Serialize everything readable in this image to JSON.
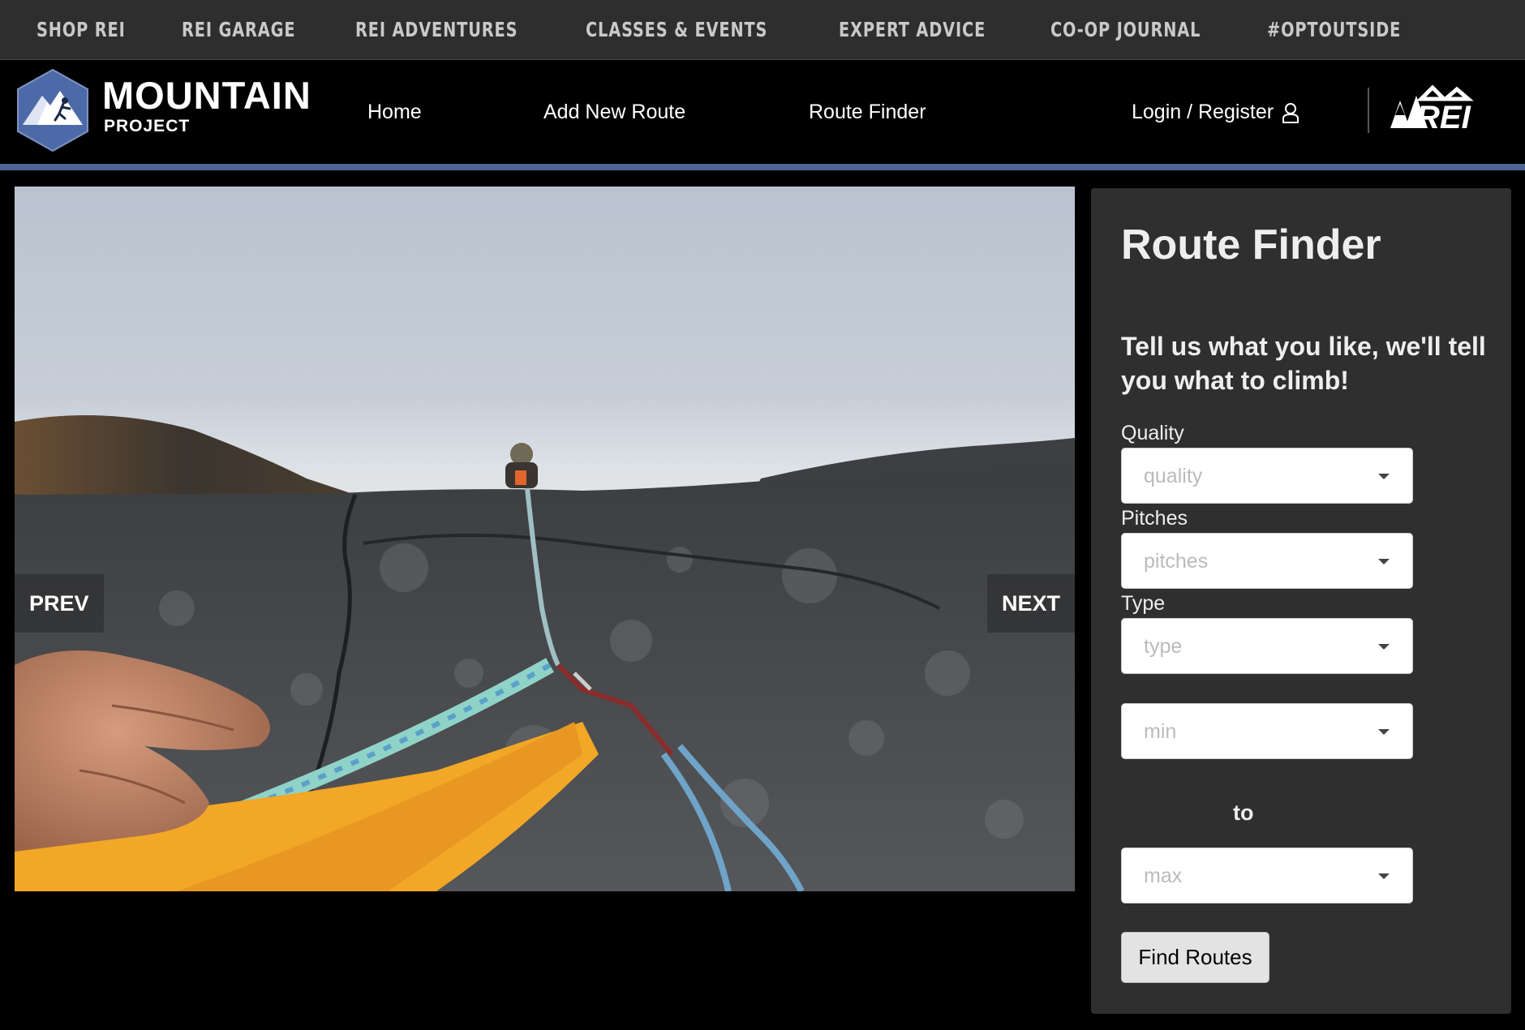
{
  "rei_bar": {
    "items": [
      "SHOP REI",
      "REI GARAGE",
      "REI ADVENTURES",
      "CLASSES & EVENTS",
      "EXPERT ADVICE",
      "CO-OP JOURNAL",
      "#OPTOUTSIDE"
    ]
  },
  "header": {
    "logo_title": "MOUNTAIN",
    "logo_subtitle": "PROJECT",
    "nav": [
      "Home",
      "Add New Route",
      "Route Finder"
    ],
    "login": "Login / Register",
    "partner_logo": "REI"
  },
  "hero": {
    "prev_label": "PREV",
    "next_label": "NEXT"
  },
  "route_finder": {
    "title": "Route Finder",
    "tagline": "Tell us what you like, we'll tell you what to climb!",
    "quality_label": "Quality",
    "quality_placeholder": "quality",
    "pitches_label": "Pitches",
    "pitches_placeholder": "pitches",
    "type_label": "Type",
    "type_placeholder": "type",
    "min_placeholder": "min",
    "to_label": "to",
    "max_placeholder": "max",
    "submit_label": "Find Routes"
  },
  "colors": {
    "accent_stripe": "#4d6494",
    "top_bar": "#2e2e2e",
    "sidebar": "#2f2f2f"
  }
}
